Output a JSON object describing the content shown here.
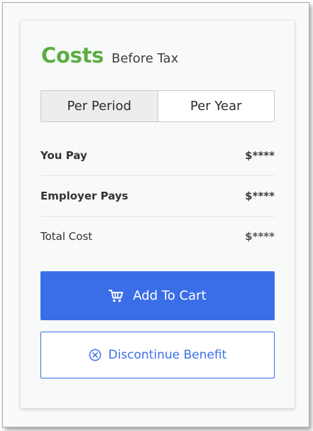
{
  "header": {
    "title": "Costs",
    "subtitle": "Before Tax"
  },
  "period_toggle": {
    "options": [
      "Per Period",
      "Per Year"
    ],
    "selected": "Per Period"
  },
  "cost_rows": [
    {
      "label": "You Pay",
      "amount": "$****"
    },
    {
      "label": "Employer Pays",
      "amount": "$****"
    },
    {
      "label": "Total Cost",
      "amount": "$****"
    }
  ],
  "actions": {
    "add_to_cart": "Add To Cart",
    "discontinue": "Discontinue Benefit"
  },
  "icons": {
    "cart": "cart-icon",
    "discontinue": "close-circle-icon"
  },
  "colors": {
    "accent_green": "#5cad45",
    "primary_blue": "#3a6ee8"
  }
}
